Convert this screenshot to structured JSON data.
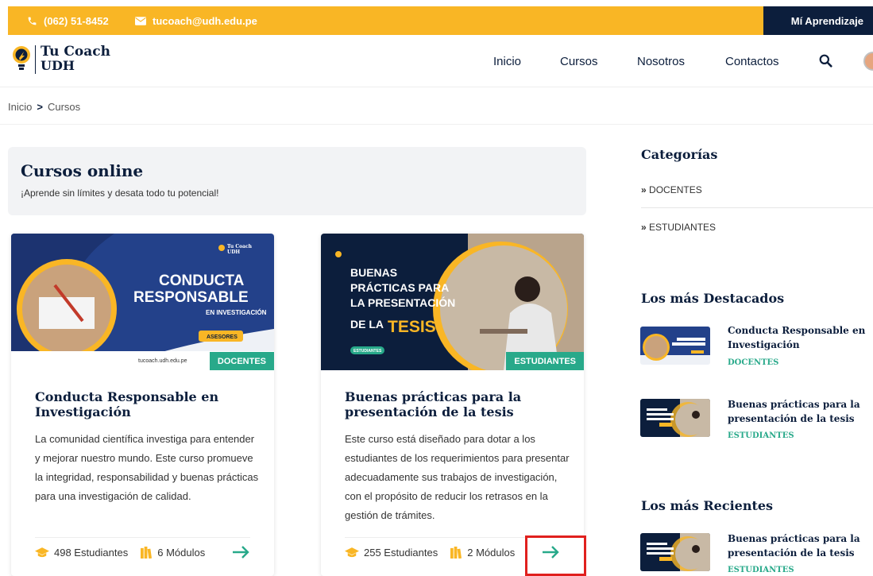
{
  "topbar": {
    "phone": "(062) 51-8452",
    "email": "tucoach@udh.edu.pe",
    "my_learning": "Mí Aprendizaje"
  },
  "header": {
    "brand_line1": "Tu Coach",
    "brand_line2": "UDH",
    "nav": [
      "Inicio",
      "Cursos",
      "Nosotros",
      "Contactos"
    ]
  },
  "breadcrumb": {
    "home": "Inicio",
    "sep": ">",
    "current": "Cursos"
  },
  "hero": {
    "title": "Cursos online",
    "subtitle": "¡Aprende sin límites y desata todo tu potencial!"
  },
  "courses": [
    {
      "thumb": {
        "title_1": "CONDUCTA",
        "title_2": "RESPONSABLE",
        "sub": "EN INVESTIGACIÓN",
        "tag": "ASESORES",
        "url": "tucoach.udh.edu.pe",
        "logo_1": "Tu Coach",
        "logo_2": "UDH"
      },
      "badge": "DOCENTES",
      "title": "Conducta Responsable en Investigación",
      "description": "La comunidad científica investiga para entender y mejorar nuestro mundo. Este curso promueve la integridad, responsabilidad y buenas prácticas para una investigación de calidad.",
      "students": "498 Estudiantes",
      "modules": "6 Módulos"
    },
    {
      "thumb": {
        "line_1": "BUENAS",
        "line_2": "PRÁCTICAS PARA",
        "line_3": "LA PRESENTACIÓN",
        "line_4a": "DE LA",
        "line_4b": "TESIS",
        "tag": "ESTUDIANTES"
      },
      "badge": "ESTUDIANTES",
      "title": "Buenas prácticas para la presentación de la tesis",
      "description": "Este curso está diseñado para dotar a los estudiantes de los requerimientos para presentar adecuadamente sus trabajos de investigación, con el propósito de reducir los retrasos en la gestión de trámites.",
      "students": "255 Estudiantes",
      "modules": "2 Módulos"
    }
  ],
  "sidebar": {
    "categories_title": "Categorías",
    "categories": [
      "DOCENTES",
      "ESTUDIANTES"
    ],
    "featured_title": "Los más Destacados",
    "featured": [
      {
        "title": "Conducta Responsable en Investigación",
        "category": "DOCENTES"
      },
      {
        "title": "Buenas prácticas para la presentación de la tesis",
        "category": "ESTUDIANTES"
      }
    ],
    "recent_title": "Los más Recientes",
    "recent": [
      {
        "title": "Buenas prácticas para la presentación de la tesis",
        "category": "ESTUDIANTES"
      }
    ]
  },
  "colors": {
    "accent_yellow": "#f9b625",
    "navy": "#0c1e3c",
    "teal": "#28a98a",
    "highlight_red": "#e0201e"
  }
}
